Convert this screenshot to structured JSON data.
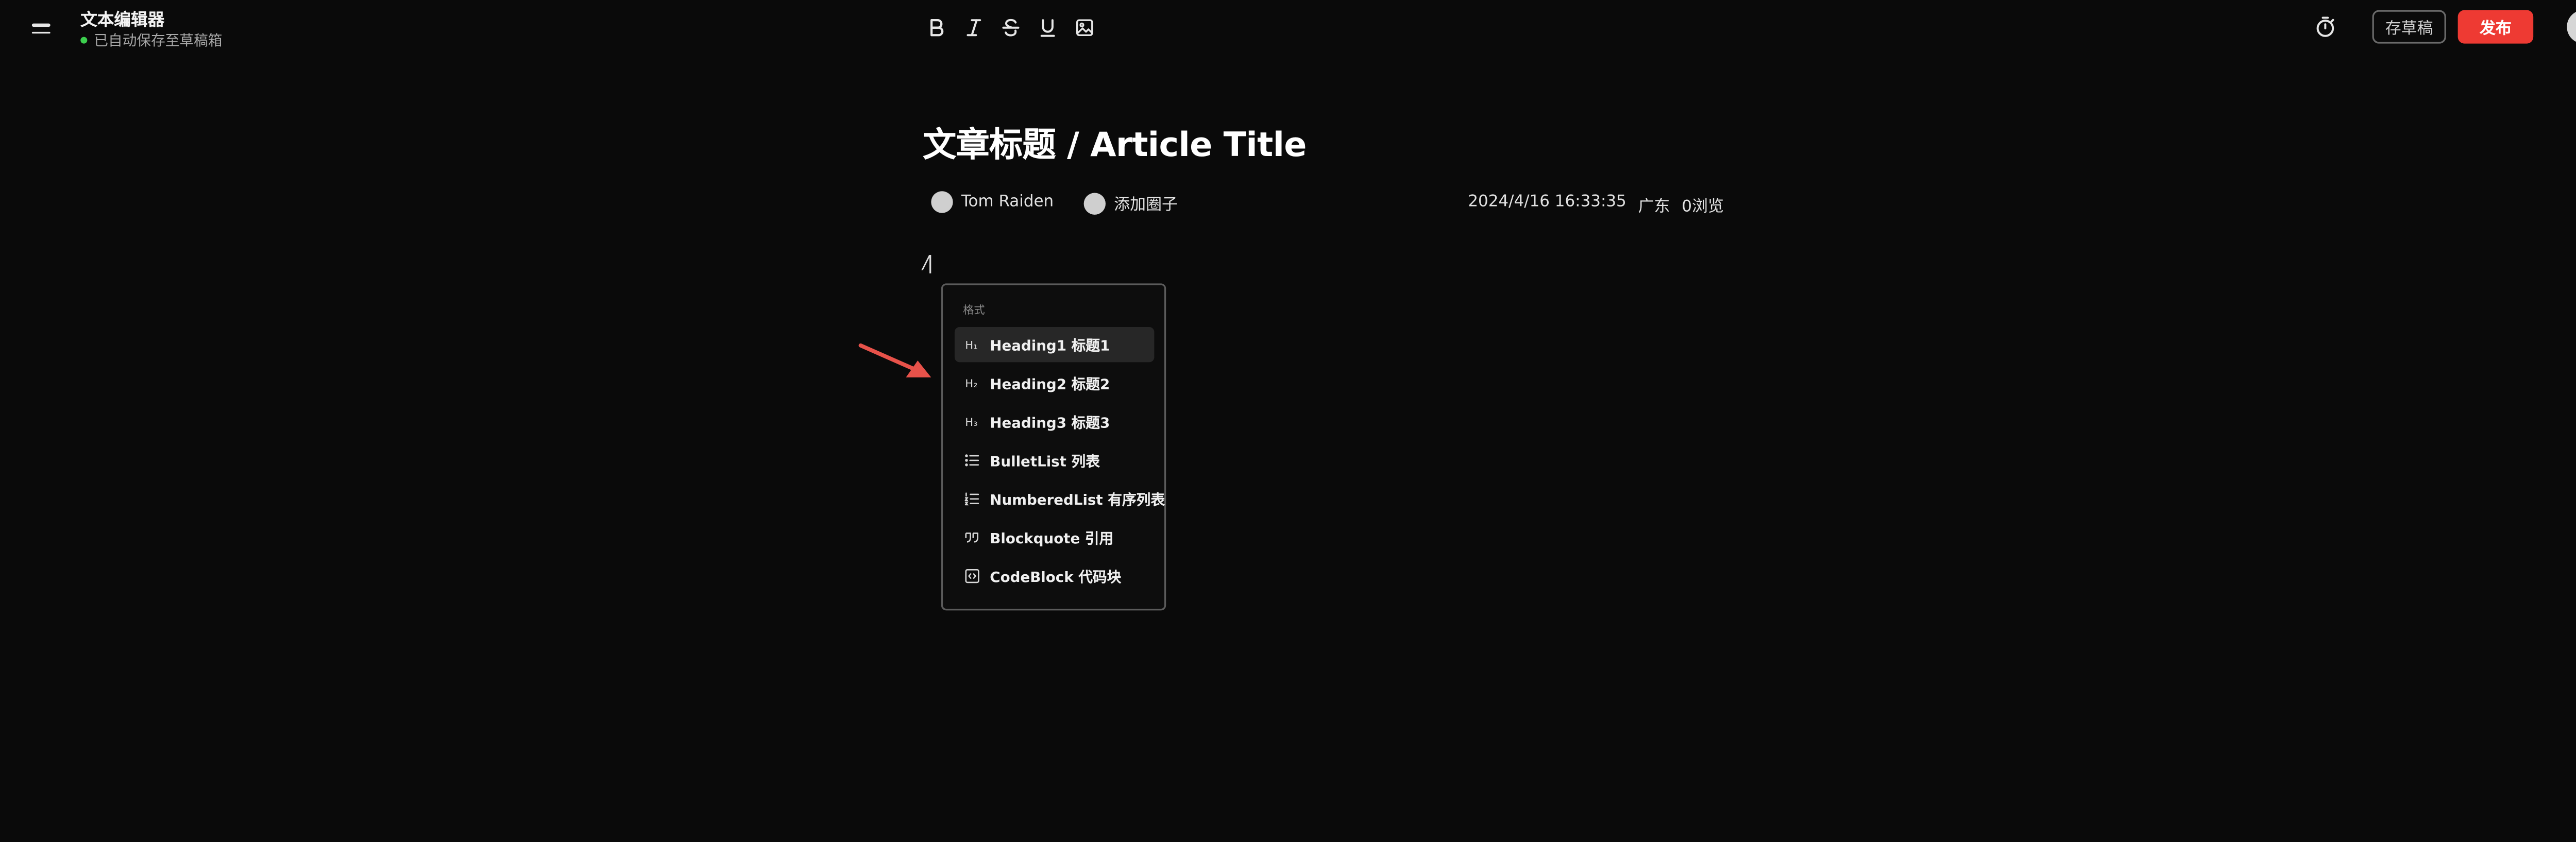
{
  "app": {
    "title": "文本编辑器",
    "save_status": "已自动保存至草稿箱"
  },
  "toolbar": {
    "buttons": [
      {
        "icon": "bold-icon",
        "tooltip": "B"
      },
      {
        "icon": "italic-icon",
        "tooltip": "I"
      },
      {
        "icon": "strikethrough-icon",
        "tooltip": "S"
      },
      {
        "icon": "underline-icon",
        "tooltip": "U"
      },
      {
        "icon": "image-icon",
        "tooltip": "image"
      }
    ]
  },
  "header_actions": {
    "timer_icon": "timer-icon",
    "draft_label": "存草稿",
    "publish_label": "发布",
    "avatar_icon": "user-avatar"
  },
  "article": {
    "title": "文章标题 / Article Title",
    "author": "Tom Raiden",
    "circle_label": "添加圈子",
    "datetime": "2024/4/16 16:33:35",
    "location": "广东",
    "views": "0浏览"
  },
  "editor": {
    "content": "/"
  },
  "slash_menu": {
    "section_label": "格式",
    "items": [
      {
        "icon": "h1-icon",
        "icon_text": "H₁",
        "label": "Heading1 标题1",
        "active": true
      },
      {
        "icon": "h2-icon",
        "icon_text": "H₂",
        "label": "Heading2 标题2",
        "active": false
      },
      {
        "icon": "h3-icon",
        "icon_text": "H₃",
        "label": "Heading3 标题3",
        "active": false
      },
      {
        "icon": "bullet-list-icon",
        "icon_text": "",
        "label": "BulletList 列表",
        "active": false
      },
      {
        "icon": "numbered-list-icon",
        "icon_text": "",
        "label": "NumberedList 有序列表",
        "active": false
      },
      {
        "icon": "blockquote-icon",
        "icon_text": "",
        "label": "Blockquote 引用",
        "active": false
      },
      {
        "icon": "code-block-icon",
        "icon_text": "",
        "label": "CodeBlock 代码块",
        "active": false
      }
    ]
  },
  "colors": {
    "background": "#0a0a0a",
    "publish": "#ee3a33",
    "status_dot": "#3ccf4e",
    "arrow": "#e8524a"
  }
}
